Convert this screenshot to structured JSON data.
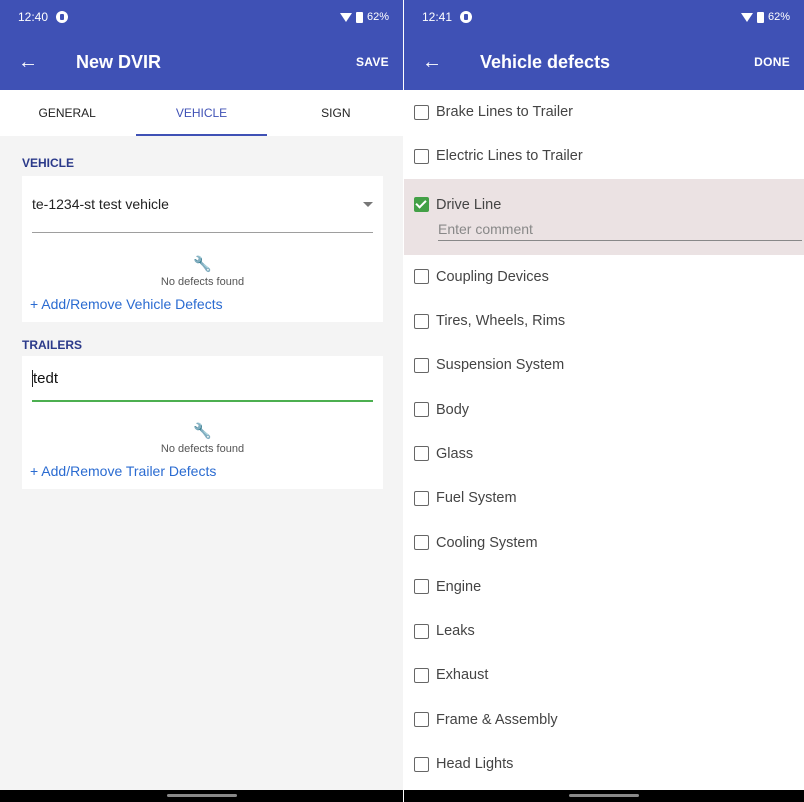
{
  "left": {
    "status": {
      "time": "12:40",
      "battery": "62%"
    },
    "appbar": {
      "title": "New DVIR",
      "action": "SAVE"
    },
    "tabs": [
      "GENERAL",
      "VEHICLE",
      "SIGN"
    ],
    "vehicle": {
      "label": "VEHICLE",
      "selected": "te-1234-st test vehicle",
      "defect_status": "No defects found",
      "add_link": "+ Add/Remove Vehicle Defects"
    },
    "trailers": {
      "label": "TRAILERS",
      "value": "tedt",
      "defect_status": "No defects found",
      "add_link": "+ Add/Remove Trailer Defects"
    }
  },
  "right": {
    "status": {
      "time": "12:41",
      "battery": "62%"
    },
    "appbar": {
      "title": "Vehicle defects",
      "action": "DONE"
    },
    "defects": [
      {
        "label": "Brake Lines to Trailer",
        "checked": false
      },
      {
        "label": "Electric Lines to Trailer",
        "checked": false
      },
      {
        "label": "Drive Line",
        "checked": true
      },
      {
        "label": "Coupling Devices",
        "checked": false
      },
      {
        "label": "Tires, Wheels, Rims",
        "checked": false
      },
      {
        "label": "Suspension System",
        "checked": false
      },
      {
        "label": "Body",
        "checked": false
      },
      {
        "label": "Glass",
        "checked": false
      },
      {
        "label": "Fuel System",
        "checked": false
      },
      {
        "label": "Cooling System",
        "checked": false
      },
      {
        "label": "Engine",
        "checked": false
      },
      {
        "label": "Leaks",
        "checked": false
      },
      {
        "label": "Exhaust",
        "checked": false
      },
      {
        "label": "Frame & Assembly",
        "checked": false
      },
      {
        "label": "Head Lights",
        "checked": false
      }
    ],
    "comment_placeholder": "Enter comment"
  },
  "colors": {
    "primary": "#3f51b5",
    "link": "#2a6bd1",
    "check": "#43a047",
    "selected_row": "#ebe2e3"
  },
  "icons": [
    "arrow-back-icon",
    "wrench-icon",
    "dropdown-caret-icon",
    "wifi-icon",
    "battery-icon",
    "checkbox-icon"
  ]
}
